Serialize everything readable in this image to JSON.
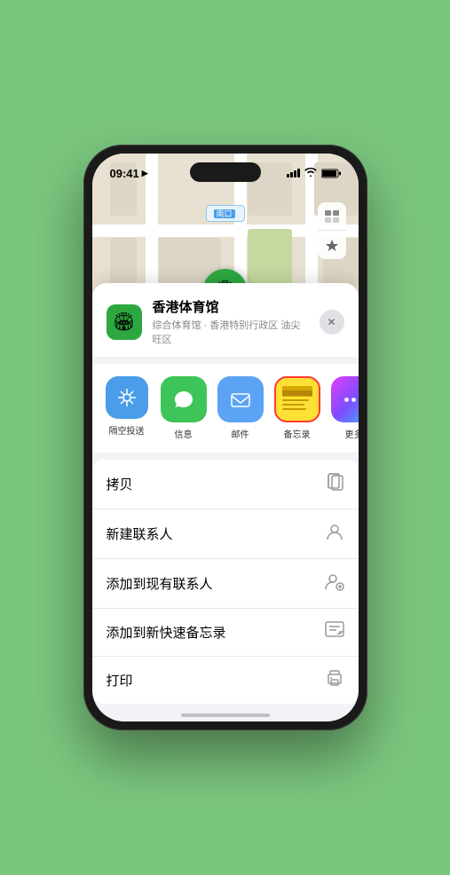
{
  "status_bar": {
    "time": "09:41",
    "location_arrow": "▶"
  },
  "map": {
    "location_label": "南口",
    "pin_label": "香港体育馆",
    "controls": {
      "map_icon": "🗺",
      "location_icon": "⇗"
    }
  },
  "sheet": {
    "venue_name": "香港体育馆",
    "venue_sub": "综合体育馆 · 香港特别行政区 油尖旺区",
    "close_label": "✕"
  },
  "share_items": [
    {
      "id": "airdrop",
      "label": "隔空投送"
    },
    {
      "id": "message",
      "label": "信息"
    },
    {
      "id": "mail",
      "label": "邮件"
    },
    {
      "id": "notes",
      "label": "备忘录"
    },
    {
      "id": "more",
      "label": "更多"
    }
  ],
  "actions": [
    {
      "label": "拷贝",
      "icon": "⎘"
    },
    {
      "label": "新建联系人",
      "icon": "👤"
    },
    {
      "label": "添加到现有联系人",
      "icon": "👤"
    },
    {
      "label": "添加到新快速备忘录",
      "icon": "📋"
    },
    {
      "label": "打印",
      "icon": "🖨"
    }
  ]
}
